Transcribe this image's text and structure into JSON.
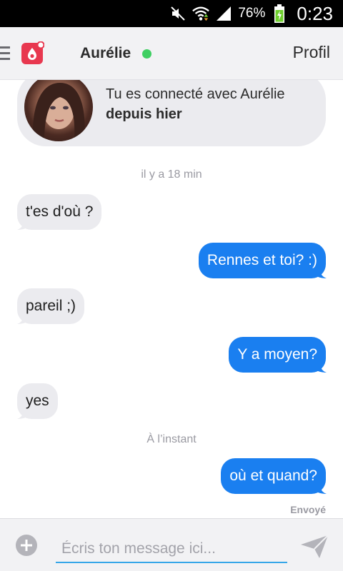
{
  "status_bar": {
    "battery_percent": "76%",
    "time": "0:23",
    "icons": [
      "mute-icon",
      "wifi-icon",
      "signal-icon",
      "battery-charging-icon"
    ]
  },
  "app_bar": {
    "contact_name": "Aurélie",
    "online": true,
    "profile_label": "Profil",
    "logo_color": "#e8384f"
  },
  "match_card": {
    "line1": "Tu es connecté avec Aurélie",
    "line2": "depuis hier"
  },
  "conversation": {
    "timestamp_1": "il y a 18 min",
    "messages": [
      {
        "direction": "in",
        "text": "t'es d'où ?"
      },
      {
        "direction": "out",
        "text": "Rennes et toi? :)"
      },
      {
        "direction": "in",
        "text": "pareil ;)"
      },
      {
        "direction": "out",
        "text": "Y a moyen?"
      },
      {
        "direction": "in",
        "text": "yes"
      },
      {
        "direction": "out",
        "text": "où et quand?"
      }
    ],
    "timestamp_2": "À l’instant",
    "sent_status": "Envoyé"
  },
  "composer": {
    "placeholder": "Écris ton message ici...",
    "value": ""
  },
  "colors": {
    "outgoing_bubble": "#1a7ff0",
    "incoming_bubble": "#ebebef",
    "online_dot": "#3fcf62",
    "input_underline": "#36a6e8"
  }
}
